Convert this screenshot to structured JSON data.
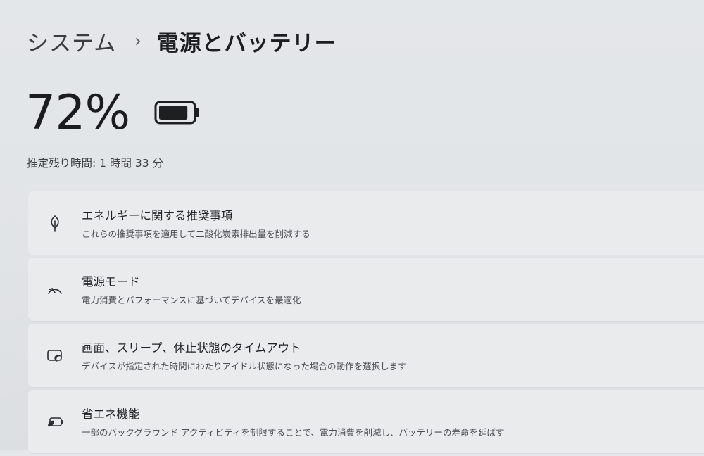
{
  "breadcrumb": {
    "parent": "システム",
    "separator": "›",
    "current": "電源とバッテリー"
  },
  "battery": {
    "percent_label": "72%",
    "level": 0.72,
    "icon": "battery-icon"
  },
  "remaining_time": "推定残り時間: 1 時間 33 分",
  "cards": [
    {
      "icon": "leaf-icon",
      "title": "エネルギーに関する推奨事項",
      "description": "これらの推奨事項を適用して二酸化炭素排出量を削減する"
    },
    {
      "icon": "speedometer-icon",
      "title": "電源モード",
      "description": "電力消費とパフォーマンスに基づいてデバイスを最適化"
    },
    {
      "icon": "screen-sleep-icon",
      "title": "画面、スリープ、休止状態のタイムアウト",
      "description": "デバイスが指定された時間にわたりアイドル状態になった場合の動作を選択します"
    },
    {
      "icon": "battery-saver-icon",
      "title": "省エネ機能",
      "description": "一部のバックグラウンド アクティビティを制限することで、電力消費を削減し、バッテリーの寿命を延ばす"
    }
  ]
}
